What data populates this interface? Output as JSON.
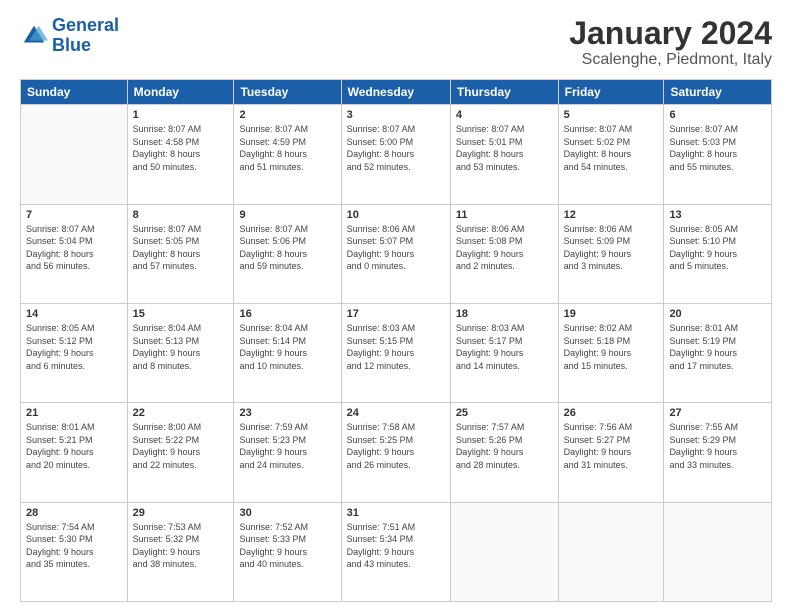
{
  "logo": {
    "line1": "General",
    "line2": "Blue"
  },
  "title": "January 2024",
  "subtitle": "Scalenghe, Piedmont, Italy",
  "weekdays": [
    "Sunday",
    "Monday",
    "Tuesday",
    "Wednesday",
    "Thursday",
    "Friday",
    "Saturday"
  ],
  "weeks": [
    [
      {
        "day": "",
        "info": ""
      },
      {
        "day": "1",
        "info": "Sunrise: 8:07 AM\nSunset: 4:58 PM\nDaylight: 8 hours\nand 50 minutes."
      },
      {
        "day": "2",
        "info": "Sunrise: 8:07 AM\nSunset: 4:59 PM\nDaylight: 8 hours\nand 51 minutes."
      },
      {
        "day": "3",
        "info": "Sunrise: 8:07 AM\nSunset: 5:00 PM\nDaylight: 8 hours\nand 52 minutes."
      },
      {
        "day": "4",
        "info": "Sunrise: 8:07 AM\nSunset: 5:01 PM\nDaylight: 8 hours\nand 53 minutes."
      },
      {
        "day": "5",
        "info": "Sunrise: 8:07 AM\nSunset: 5:02 PM\nDaylight: 8 hours\nand 54 minutes."
      },
      {
        "day": "6",
        "info": "Sunrise: 8:07 AM\nSunset: 5:03 PM\nDaylight: 8 hours\nand 55 minutes."
      }
    ],
    [
      {
        "day": "7",
        "info": "Sunrise: 8:07 AM\nSunset: 5:04 PM\nDaylight: 8 hours\nand 56 minutes."
      },
      {
        "day": "8",
        "info": "Sunrise: 8:07 AM\nSunset: 5:05 PM\nDaylight: 8 hours\nand 57 minutes."
      },
      {
        "day": "9",
        "info": "Sunrise: 8:07 AM\nSunset: 5:06 PM\nDaylight: 8 hours\nand 59 minutes."
      },
      {
        "day": "10",
        "info": "Sunrise: 8:06 AM\nSunset: 5:07 PM\nDaylight: 9 hours\nand 0 minutes."
      },
      {
        "day": "11",
        "info": "Sunrise: 8:06 AM\nSunset: 5:08 PM\nDaylight: 9 hours\nand 2 minutes."
      },
      {
        "day": "12",
        "info": "Sunrise: 8:06 AM\nSunset: 5:09 PM\nDaylight: 9 hours\nand 3 minutes."
      },
      {
        "day": "13",
        "info": "Sunrise: 8:05 AM\nSunset: 5:10 PM\nDaylight: 9 hours\nand 5 minutes."
      }
    ],
    [
      {
        "day": "14",
        "info": "Sunrise: 8:05 AM\nSunset: 5:12 PM\nDaylight: 9 hours\nand 6 minutes."
      },
      {
        "day": "15",
        "info": "Sunrise: 8:04 AM\nSunset: 5:13 PM\nDaylight: 9 hours\nand 8 minutes."
      },
      {
        "day": "16",
        "info": "Sunrise: 8:04 AM\nSunset: 5:14 PM\nDaylight: 9 hours\nand 10 minutes."
      },
      {
        "day": "17",
        "info": "Sunrise: 8:03 AM\nSunset: 5:15 PM\nDaylight: 9 hours\nand 12 minutes."
      },
      {
        "day": "18",
        "info": "Sunrise: 8:03 AM\nSunset: 5:17 PM\nDaylight: 9 hours\nand 14 minutes."
      },
      {
        "day": "19",
        "info": "Sunrise: 8:02 AM\nSunset: 5:18 PM\nDaylight: 9 hours\nand 15 minutes."
      },
      {
        "day": "20",
        "info": "Sunrise: 8:01 AM\nSunset: 5:19 PM\nDaylight: 9 hours\nand 17 minutes."
      }
    ],
    [
      {
        "day": "21",
        "info": "Sunrise: 8:01 AM\nSunset: 5:21 PM\nDaylight: 9 hours\nand 20 minutes."
      },
      {
        "day": "22",
        "info": "Sunrise: 8:00 AM\nSunset: 5:22 PM\nDaylight: 9 hours\nand 22 minutes."
      },
      {
        "day": "23",
        "info": "Sunrise: 7:59 AM\nSunset: 5:23 PM\nDaylight: 9 hours\nand 24 minutes."
      },
      {
        "day": "24",
        "info": "Sunrise: 7:58 AM\nSunset: 5:25 PM\nDaylight: 9 hours\nand 26 minutes."
      },
      {
        "day": "25",
        "info": "Sunrise: 7:57 AM\nSunset: 5:26 PM\nDaylight: 9 hours\nand 28 minutes."
      },
      {
        "day": "26",
        "info": "Sunrise: 7:56 AM\nSunset: 5:27 PM\nDaylight: 9 hours\nand 31 minutes."
      },
      {
        "day": "27",
        "info": "Sunrise: 7:55 AM\nSunset: 5:29 PM\nDaylight: 9 hours\nand 33 minutes."
      }
    ],
    [
      {
        "day": "28",
        "info": "Sunrise: 7:54 AM\nSunset: 5:30 PM\nDaylight: 9 hours\nand 35 minutes."
      },
      {
        "day": "29",
        "info": "Sunrise: 7:53 AM\nSunset: 5:32 PM\nDaylight: 9 hours\nand 38 minutes."
      },
      {
        "day": "30",
        "info": "Sunrise: 7:52 AM\nSunset: 5:33 PM\nDaylight: 9 hours\nand 40 minutes."
      },
      {
        "day": "31",
        "info": "Sunrise: 7:51 AM\nSunset: 5:34 PM\nDaylight: 9 hours\nand 43 minutes."
      },
      {
        "day": "",
        "info": ""
      },
      {
        "day": "",
        "info": ""
      },
      {
        "day": "",
        "info": ""
      }
    ]
  ]
}
